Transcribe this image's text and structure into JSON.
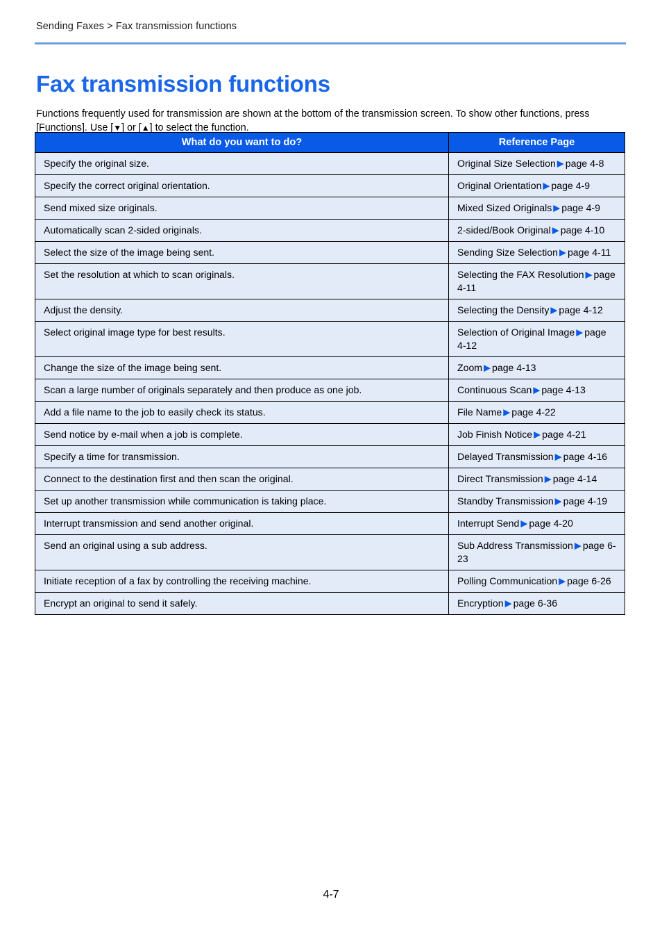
{
  "header": {
    "breadcrumb": "Sending Faxes > Fax transmission functions"
  },
  "title": "Fax transmission functions",
  "intro": {
    "text_part1": "Functions frequently used for transmission are shown at the bottom of the transmission screen. To show other functions, press [Functions]. Use [",
    "down_triangle": "▼",
    "text_part2": "] or [",
    "up_triangle": "▲",
    "text_part3": "] to select the function."
  },
  "table": {
    "columns": [
      "What do you want to do?",
      "Reference Page"
    ],
    "arrow_glyph": "▶",
    "rows": [
      {
        "task": "Specify the original size.",
        "ref_name": "Original Size Selection",
        "ref_page": "page 4-8",
        "tall": false
      },
      {
        "task": "Specify the correct original orientation.",
        "ref_name": "Original Orientation",
        "ref_page": "page 4-9",
        "tall": false
      },
      {
        "task": "Send mixed size originals.",
        "ref_name": "Mixed Sized Originals",
        "ref_page": "page 4-9",
        "tall": false
      },
      {
        "task": "Automatically scan 2-sided originals.",
        "ref_name": "2-sided/Book Original",
        "ref_page": "page 4-10",
        "tall": false
      },
      {
        "task": "Select the size of the image being sent.",
        "ref_name": "Sending Size Selection",
        "ref_page": "page 4-11",
        "tall": false
      },
      {
        "task": "Set the resolution at which to scan originals.",
        "ref_name": "Selecting the FAX Resolution",
        "ref_page": "page 4-11",
        "tall": true
      },
      {
        "task": "Adjust the density.",
        "ref_name": "Selecting the Density",
        "ref_page": "page 4-12",
        "tall": false
      },
      {
        "task": "Select original image type for best results.",
        "ref_name": "Selection of Original Image",
        "ref_page": "page 4-12",
        "tall": true
      },
      {
        "task": "Change the size of the image being sent.",
        "ref_name": "Zoom",
        "ref_page": "page 4-13",
        "tall": false
      },
      {
        "task": "Scan a large number of originals separately and then produce as one job.",
        "ref_name": "Continuous Scan",
        "ref_page": "page 4-13",
        "tall": false
      },
      {
        "task": "Add a file name to the job to easily check its status.",
        "ref_name": "File Name",
        "ref_page": "page 4-22",
        "tall": false
      },
      {
        "task": "Send notice by e-mail when a job is complete.",
        "ref_name": "Job Finish Notice",
        "ref_page": "page 4-21",
        "tall": false
      },
      {
        "task": "Specify a time for transmission.",
        "ref_name": "Delayed Transmission",
        "ref_page": "page 4-16",
        "tall": false
      },
      {
        "task": "Connect to the destination first and then scan the original.",
        "ref_name": "Direct Transmission",
        "ref_page": "page 4-14",
        "tall": false
      },
      {
        "task": "Set up another transmission while communication is taking place.",
        "ref_name": "Standby Transmission",
        "ref_page": "page 4-19",
        "tall": false
      },
      {
        "task": "Interrupt transmission and send another original.",
        "ref_name": "Interrupt Send",
        "ref_page": "page 4-20",
        "tall": false
      },
      {
        "task": "Send an original using a sub address.",
        "ref_name": "Sub Address Transmission",
        "ref_page": "page 6-23",
        "tall": true
      },
      {
        "task": "Initiate reception of a fax by controlling the receiving machine.",
        "ref_name": "Polling Communication",
        "ref_page": "page 6-26",
        "tall": false
      },
      {
        "task": "Encrypt an original to send it safely.",
        "ref_name": "Encryption",
        "ref_page": "page 6-36",
        "tall": false
      }
    ]
  },
  "footer": {
    "page_number": "4-7"
  },
  "colors": {
    "title_blue": "#1a66e8",
    "header_blue": "#0a5ae8",
    "row_blue": "#e3eaf8",
    "rule_blue": "#6c9ce0"
  }
}
